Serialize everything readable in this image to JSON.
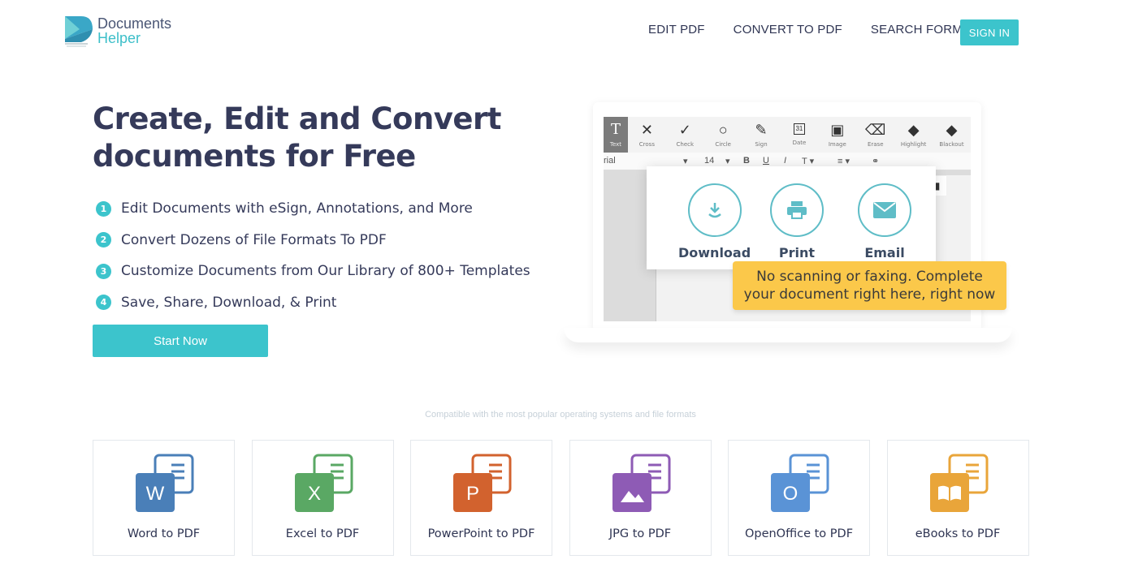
{
  "brand": {
    "line1": "Documents",
    "line2": "Helper",
    "accent": "#3cc4cc"
  },
  "nav": {
    "items": [
      "EDIT PDF",
      "CONVERT TO PDF",
      "SEARCH FORMS"
    ],
    "signin_label": "SIGN IN"
  },
  "hero": {
    "title_line1": "Create, Edit and Convert",
    "title_line2": "documents for Free",
    "features": [
      {
        "num": "1",
        "text": "Edit Documents with eSign, Annotations, and More"
      },
      {
        "num": "2",
        "text": "Convert Dozens of File Formats To PDF"
      },
      {
        "num": "3",
        "text": "Customize Documents from Our Library of 800+ Templates"
      },
      {
        "num": "4",
        "text": "Save, Share, Download, & Print"
      }
    ],
    "cta_label": "Start Now"
  },
  "editor": {
    "tools": [
      {
        "icon": "text-icon",
        "label": "Text"
      },
      {
        "icon": "cross-icon",
        "label": "Cross"
      },
      {
        "icon": "check-icon",
        "label": "Check"
      },
      {
        "icon": "circle-icon",
        "label": "Circle"
      },
      {
        "icon": "sign-icon",
        "label": "Sign"
      },
      {
        "icon": "date-icon",
        "label": "Date"
      },
      {
        "icon": "image-icon",
        "label": "Image"
      },
      {
        "icon": "erase-icon",
        "label": "Erase"
      },
      {
        "icon": "highlight-icon",
        "label": "Highlight"
      },
      {
        "icon": "blackout-icon",
        "label": "Blackout"
      }
    ],
    "font_name": "rial",
    "font_size": "14",
    "date_day": "31",
    "modal_options": [
      "Download",
      "Print",
      "Email"
    ],
    "callout_line1": "No scanning or faxing. Complete",
    "callout_line2": "your document right here, right now"
  },
  "compat": {
    "caption": "Compatible with the most popular operating systems and file formats",
    "cards": [
      {
        "label": "Word to PDF",
        "letter": "W",
        "color": "#4a7fb8"
      },
      {
        "label": "Excel to PDF",
        "letter": "X",
        "color": "#5aa864"
      },
      {
        "label": "PowerPoint to PDF",
        "letter": "P",
        "color": "#d2622e"
      },
      {
        "label": "JPG to PDF",
        "letter": "",
        "color": "#8e5bb5"
      },
      {
        "label": "OpenOffice to PDF",
        "letter": "O",
        "color": "#5a93d6"
      },
      {
        "label": "eBooks to PDF",
        "letter": "",
        "color": "#e9a53a"
      }
    ]
  }
}
